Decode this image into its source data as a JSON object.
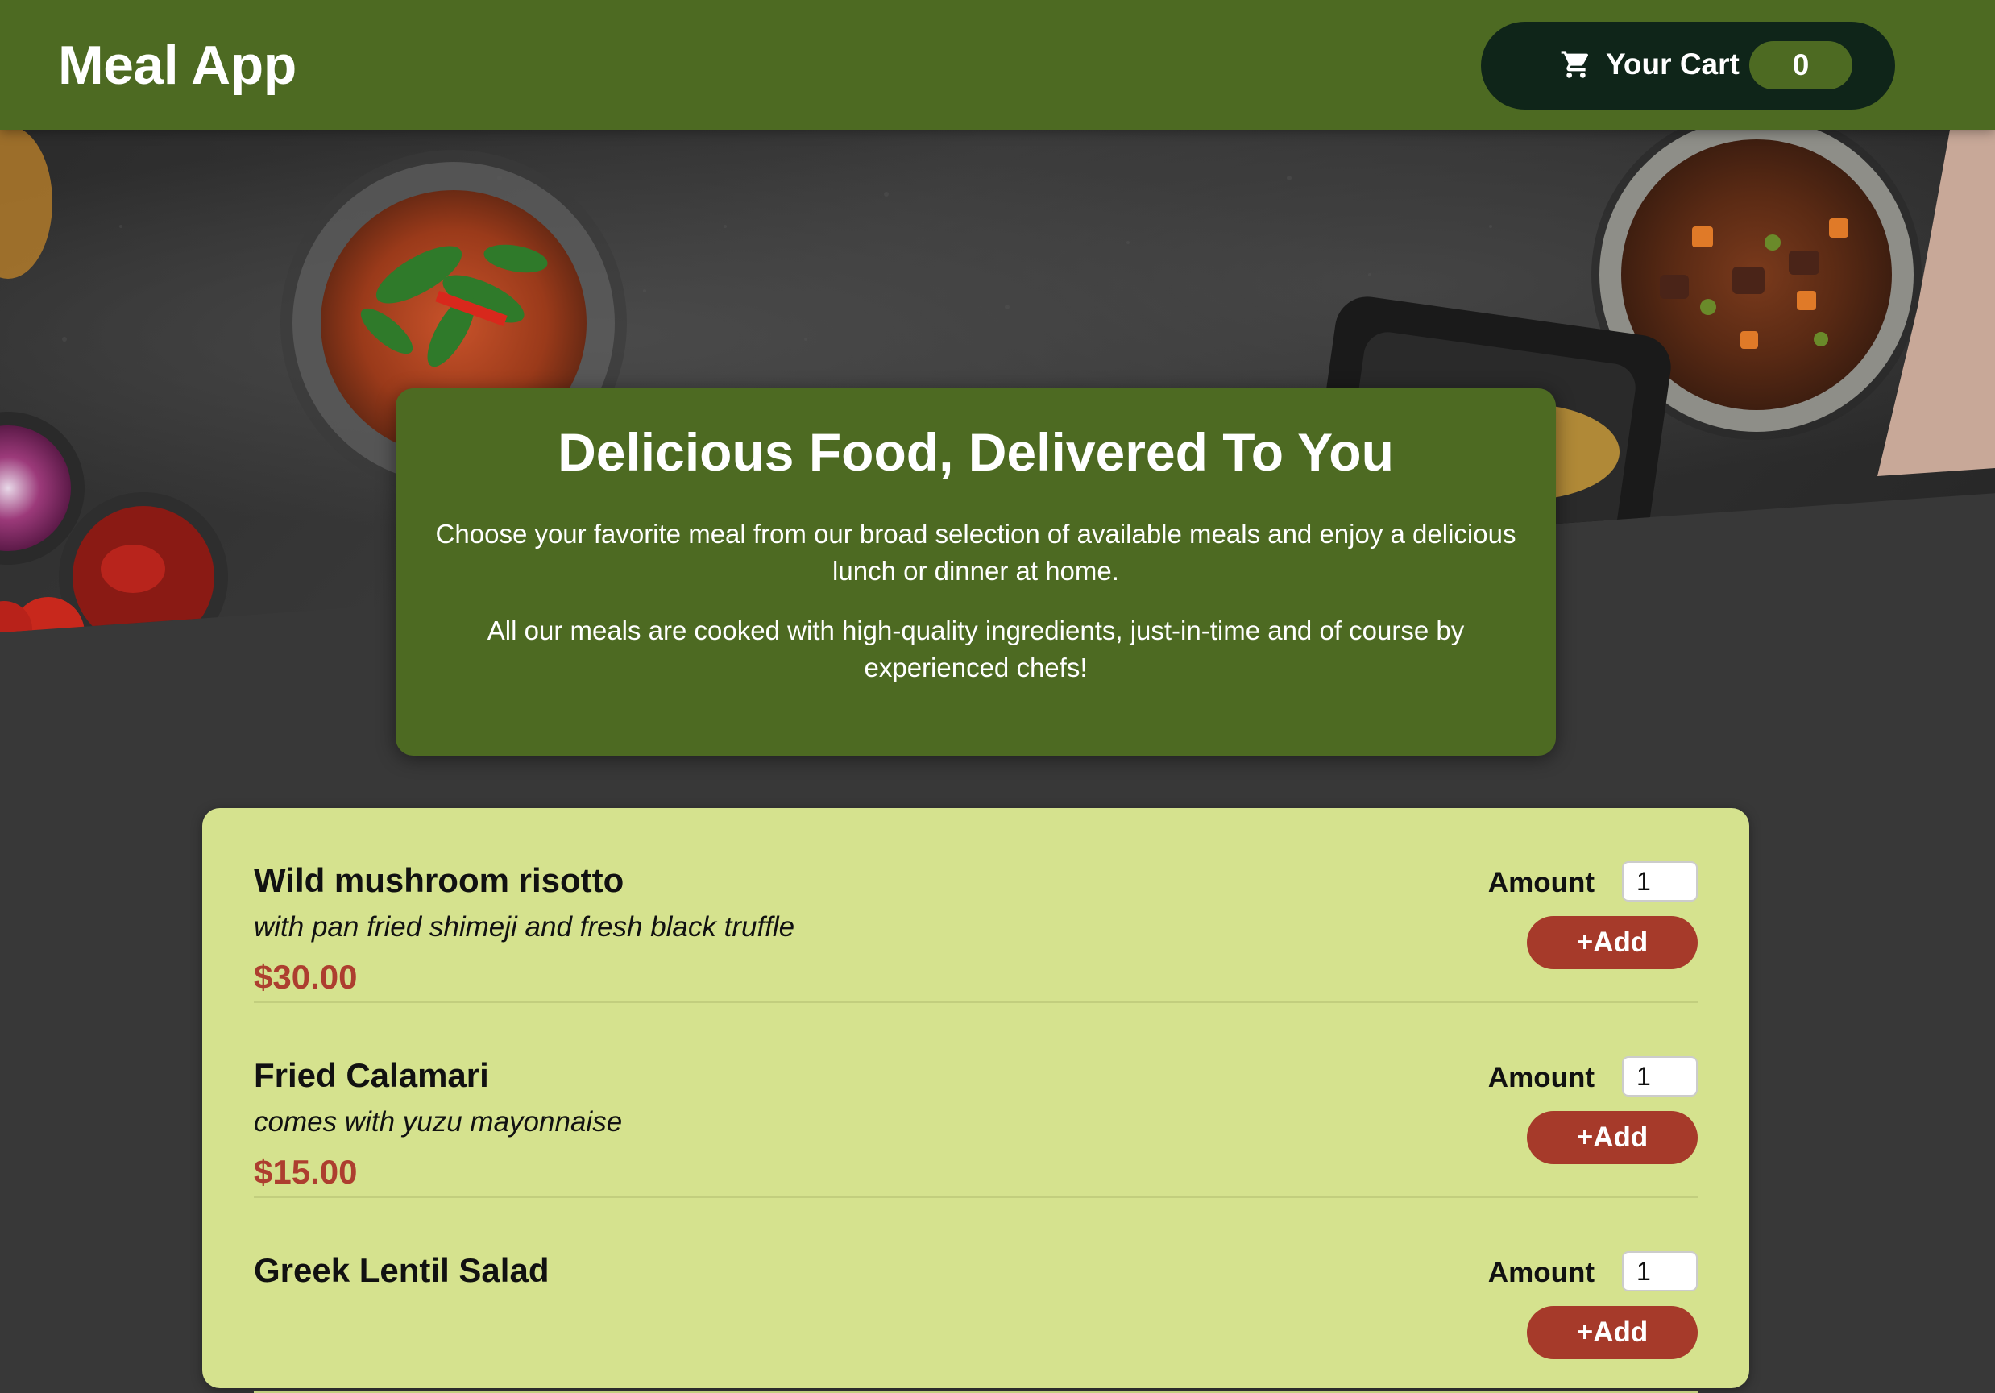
{
  "header": {
    "title": "Meal App",
    "cart": {
      "icon": "shopping-cart-icon",
      "label": "Your Cart",
      "count": "0"
    }
  },
  "hero": {
    "image": "food-table-photo"
  },
  "summary": {
    "title": "Delicious Food, Delivered To You",
    "paragraphs": [
      "Choose your favorite meal from our broad selection of available meals and enjoy a delicious lunch or dinner at home.",
      "All our meals are cooked with high-quality ingredients, just-in-time and of course by experienced chefs!"
    ]
  },
  "meals": [
    {
      "name": "Wild mushroom risotto",
      "description": "with pan fried shimeji and fresh black truffle",
      "price": "$30.00",
      "amount_label": "Amount",
      "amount": "1",
      "add_label": "+Add"
    },
    {
      "name": "Fried Calamari",
      "description": "comes with yuzu mayonnaise",
      "price": "$15.00",
      "amount_label": "Amount",
      "amount": "1",
      "add_label": "+Add"
    },
    {
      "name": "Greek Lentil Salad",
      "description": "",
      "price": "",
      "amount_label": "Amount",
      "amount": "1",
      "add_label": "+Add"
    }
  ],
  "colors": {
    "header": "#4d6a22",
    "cart_button": "#0f2519",
    "page_background": "#383838",
    "meals_card": "#d5e28e",
    "price": "#ad3e2f",
    "add_button": "#a63a2a"
  }
}
